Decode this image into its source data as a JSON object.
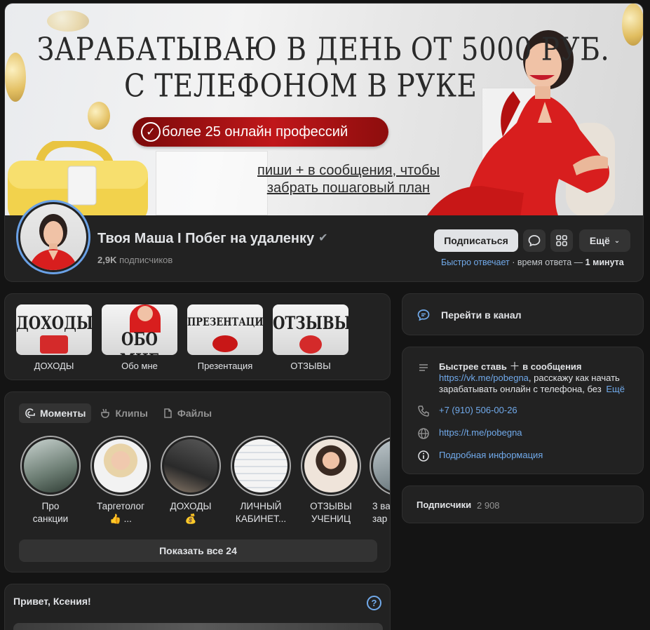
{
  "cover": {
    "line1": "ЗАРАБАТЫВАЮ В ДЕНЬ ОТ 5000 РУБ.",
    "line2": "С ТЕЛЕФОНОМ В РУКЕ",
    "pill": "более 25 онлайн профессий",
    "cta1": "пиши + в сообщения, чтобы",
    "cta2": "забрать пошаговый план"
  },
  "group": {
    "name": "Твоя Маша I Побег на удаленку",
    "subscribers_count": "2,9K",
    "subscribers_label": "подписчиков"
  },
  "actions": {
    "subscribe": "Подписаться",
    "more": "Ещё",
    "fast_reply": "Быстро отвечает",
    "reply_time_label": "время ответа —",
    "reply_time_value": "1 минута"
  },
  "albums": [
    {
      "title": "ДОХОДЫ",
      "label": "ДОХОДЫ"
    },
    {
      "title": "ОБО МНЕ",
      "label": "Обо мне"
    },
    {
      "title": "ПРЕЗЕНТАЦИЯ",
      "label": "Презентация"
    },
    {
      "title": "ОТЗЫВЫ",
      "label": "ОТЗЫВЫ"
    }
  ],
  "moments": {
    "tabs": [
      "Моменты",
      "Клипы",
      "Файлы"
    ],
    "stories": [
      {
        "line1": "Про",
        "line2": "санкции"
      },
      {
        "line1": "Таргетолог",
        "line2": "👍 ..."
      },
      {
        "line1": "ДОХОДЫ",
        "line2": "💰"
      },
      {
        "line1": "ЛИЧНЫЙ",
        "line2": "КАБИНЕТ..."
      },
      {
        "line1": "ОТЗЫВЫ",
        "line2": "УЧЕНИЦ"
      },
      {
        "line1": "3 ва",
        "line2": "зар"
      }
    ],
    "show_all": "Показать все 24"
  },
  "greeting": {
    "hello": "Привет, Ксения!",
    "help": "?"
  },
  "sidebar": {
    "channel": "Перейти в канал",
    "desc_line1": "Быстрее ставь",
    "desc_line1b": "в сообщения",
    "desc_link": "https://vk.me/pobegna",
    "desc_line2": ", расскажу как начать",
    "desc_line3": "зарабатывать онлайн с телефона, без",
    "desc_more": "Ещё",
    "phone": "+7 (910) 506-00-26",
    "site": "https://t.me/pobegna",
    "details": "Подробная информация",
    "subs_title": "Подписчики",
    "subs_count": "2 908"
  },
  "colors": {
    "accent": "#71aaeb",
    "card_bg": "#222222",
    "page_bg": "#141414",
    "cover_red": "#c0171a"
  }
}
